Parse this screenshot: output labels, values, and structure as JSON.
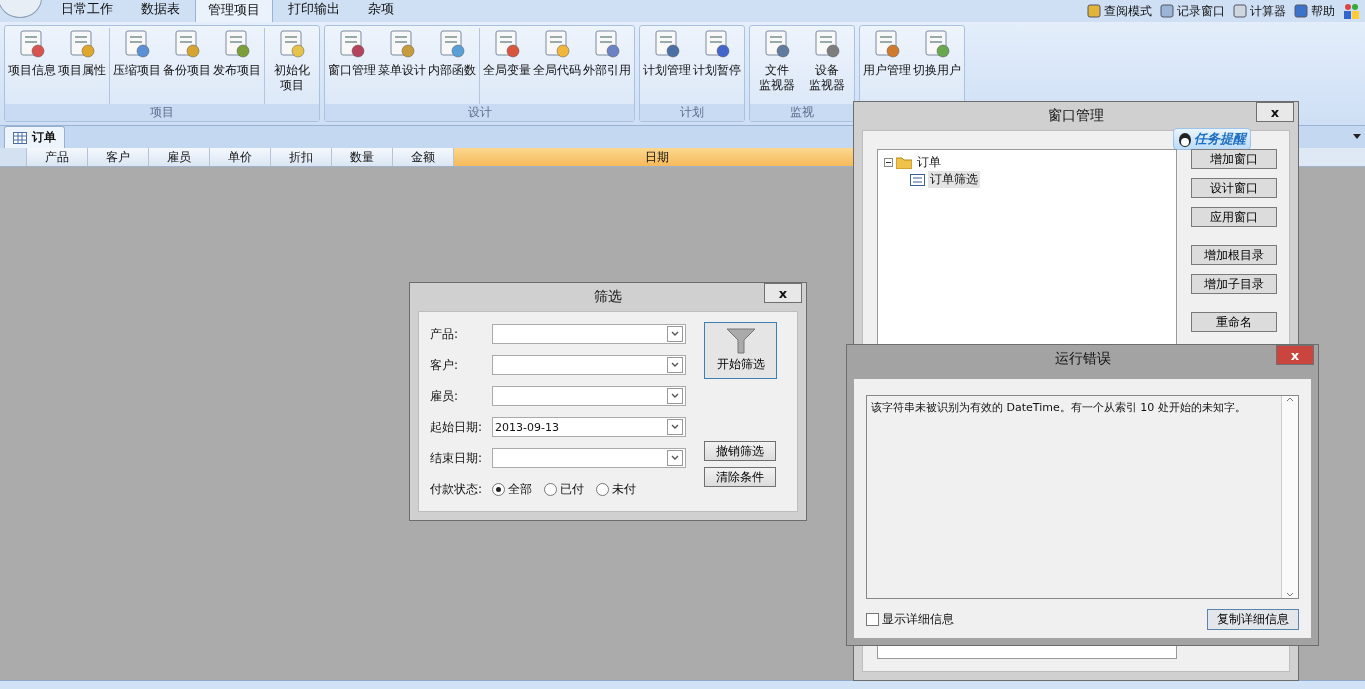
{
  "ribbon_tabs": [
    {
      "label": "日常工作",
      "selected": false
    },
    {
      "label": "数据表",
      "selected": false
    },
    {
      "label": "管理项目",
      "selected": true
    },
    {
      "label": "打印输出",
      "selected": false
    },
    {
      "label": "杂项",
      "selected": false
    }
  ],
  "top_links": [
    {
      "label": "查阅模式"
    },
    {
      "label": "记录窗口"
    },
    {
      "label": "计算器"
    },
    {
      "label": "帮助"
    }
  ],
  "ribbon_groups": [
    {
      "label": "项目",
      "sections": [
        [
          {
            "label": "项目信息"
          },
          {
            "label": "项目属性"
          }
        ],
        [
          {
            "label": "压缩项目"
          },
          {
            "label": "备份项目"
          },
          {
            "label": "发布项目"
          }
        ],
        [
          {
            "lines": [
              "初始化",
              "项目"
            ]
          }
        ]
      ]
    },
    {
      "label": "设计",
      "sections": [
        [
          {
            "label": "窗口管理"
          },
          {
            "label": "菜单设计"
          },
          {
            "label": "内部函数"
          }
        ],
        [
          {
            "label": "全局变量"
          },
          {
            "label": "全局代码"
          },
          {
            "label": "外部引用"
          }
        ]
      ]
    },
    {
      "label": "计划",
      "sections": [
        [
          {
            "label": "计划管理"
          },
          {
            "label": "计划暂停"
          }
        ]
      ]
    },
    {
      "label": "监视",
      "sections": [
        [
          {
            "lines": [
              "文件",
              "监视器"
            ]
          },
          {
            "lines": [
              "设备",
              "监视器"
            ]
          }
        ]
      ]
    },
    {
      "sections": [
        [
          {
            "label": "用户管理"
          },
          {
            "label": "切换用户"
          }
        ]
      ]
    }
  ],
  "document_tabs": [
    {
      "label": "订单",
      "selected": true
    }
  ],
  "grid": {
    "columns": [
      {
        "label": "产品",
        "selected": false
      },
      {
        "label": "客户",
        "selected": false
      },
      {
        "label": "雇员",
        "selected": false
      },
      {
        "label": "单价",
        "selected": false
      },
      {
        "label": "折扣",
        "selected": false
      },
      {
        "label": "数量",
        "selected": false
      },
      {
        "label": "金额",
        "selected": false
      },
      {
        "label": "日期",
        "selected": true
      }
    ]
  },
  "filter_dialog": {
    "title": "筛选",
    "close": "x",
    "fields": [
      {
        "label": "产品:"
      },
      {
        "label": "客户:"
      },
      {
        "label": "雇员:"
      },
      {
        "label": "起始日期:",
        "value": "2013-09-13"
      },
      {
        "label": "结束日期:"
      }
    ],
    "payment": {
      "label": "付款状态:",
      "options": [
        {
          "label": "全部",
          "selected": true
        },
        {
          "label": "已付",
          "selected": false
        },
        {
          "label": "未付",
          "selected": false
        }
      ]
    },
    "start_button": "开始筛选",
    "cancel_button": "撤销筛选",
    "clear_button": "清除条件"
  },
  "window_manager": {
    "title": "窗口管理",
    "close": "x",
    "badge": "任务提醒",
    "tree": [
      {
        "label": "订单",
        "expanded": true,
        "selected": false,
        "children": [
          {
            "label": "订单筛选",
            "selected": true
          }
        ]
      }
    ],
    "button_groups": [
      [
        "增加窗口",
        "设计窗口",
        "应用窗口"
      ],
      [
        "增加根目录",
        "增加子目录"
      ],
      [
        "重命名"
      ]
    ]
  },
  "error_dialog": {
    "title": "运行错误",
    "close": "x",
    "message": "该字符串未被识别为有效的 DateTime。有一个从索引 10 处开始的未知字。",
    "show_details": {
      "label": "显示详细信息",
      "checked": false
    },
    "copy_button": "复制详细信息"
  }
}
